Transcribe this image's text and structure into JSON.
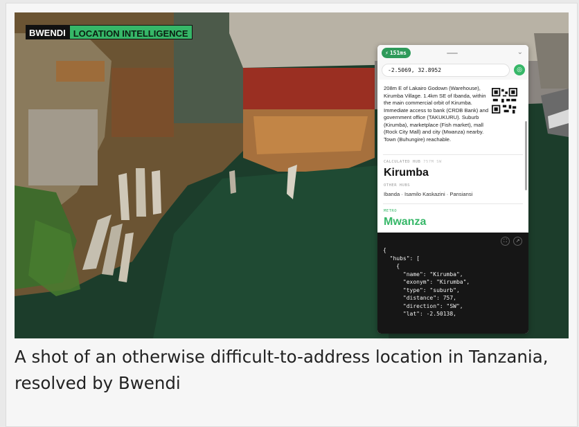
{
  "brand": {
    "name": "BWENDI",
    "tagline": "LOCATION INTELLIGENCE",
    "accent": "#36b768"
  },
  "panel": {
    "speed_badge": "151ms",
    "speed_icon": "lightning-icon",
    "coordinates": "-2.5069, 32.8952",
    "description": "208m E of Lakairo Godown (Warehouse), Kirumba Village. 1.4km SE of Ibanda, within the main commercial orbit of Kirumba. Immediate access to bank (CRDB Bank) and government office (TAKUKURU). Suburb (Kirumba), marketplace (Fish market), mall (Rock City Mall) and city (Mwanza) nearby. Town (Buhungire) reachable.",
    "calculated_hub_label": "CALCULATED HUB",
    "calculated_hub_distance": "757M SW",
    "hub_name": "Kirumba",
    "other_hubs_label": "OTHER HUBS",
    "other_hubs": "Ibanda · Isamilo Kaskazini · Pansiansi",
    "metro_label": "METRO",
    "metro_name": "Mwanza",
    "json_preview": "{\n  \"hubs\": [\n    {\n      \"name\": \"Kirumba\",\n      \"exonym\": \"Kirumba\",\n      \"type\": \"suburb\",\n      \"distance\": 757,\n      \"direction\": \"SW\",\n      \"lat\": -2.50138,"
  },
  "caption": "A shot of an otherwise difficult-to-address location in Tanzania, resolved by Bwendi"
}
